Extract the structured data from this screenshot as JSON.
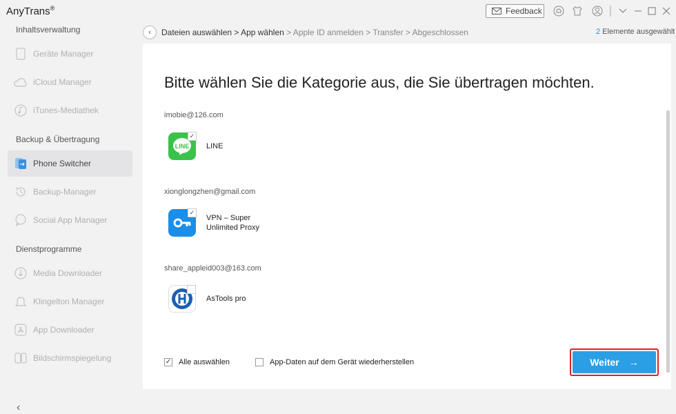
{
  "app": {
    "title": "AnyTrans",
    "trademark": "®"
  },
  "toolbar": {
    "feedback_label": "Feedback"
  },
  "sidebar": {
    "section1": "Inhaltsverwaltung",
    "items1": [
      {
        "label": "Geräte Manager",
        "icon": "phone-icon"
      },
      {
        "label": "iCloud Manager",
        "icon": "cloud-icon"
      },
      {
        "label": "iTunes-Mediathek",
        "icon": "music-icon"
      }
    ],
    "section2": "Backup & Übertragung",
    "items2": [
      {
        "label": "Phone Switcher",
        "icon": "phone-switch-icon",
        "active": true
      },
      {
        "label": "Backup-Manager",
        "icon": "history-icon"
      },
      {
        "label": "Social App Manager",
        "icon": "chat-icon"
      }
    ],
    "section3": "Dienstprogramme",
    "items3": [
      {
        "label": "Media Downloader",
        "icon": "download-icon"
      },
      {
        "label": "Klingelton Manager",
        "icon": "bell-icon"
      },
      {
        "label": "App Downloader",
        "icon": "app-store-icon"
      },
      {
        "label": "Bildschirmspiegelung",
        "icon": "mirror-icon"
      }
    ]
  },
  "breadcrumb": {
    "current": "Dateien auswählen > App wählen",
    "rest": " > Apple ID anmelden > Transfer > Abgeschlossen"
  },
  "selection": {
    "count": "2",
    "label": " Elemente ausgewählt"
  },
  "main": {
    "heading": "Bitte wählen Sie die Kategorie aus, die Sie übertragen möchten.",
    "groups": [
      {
        "account": "imobie@126.com",
        "app_name_1": "LINE",
        "app_name_2": "",
        "checked": true
      },
      {
        "account": "xionglongzhen@gmail.com",
        "app_name_1": "VPN – Super",
        "app_name_2": "Unlimited Proxy",
        "checked": true
      },
      {
        "account": "share_appleid003@163.com",
        "app_name_1": "AsTools pro",
        "app_name_2": "",
        "checked": false
      }
    ],
    "select_all_label": "Alle auswählen",
    "restore_label": "App-Daten auf dem Gerät wiederherstellen",
    "next_label": "Weiter",
    "next_arrow": "→"
  },
  "colors": {
    "accent": "#2b9fe6",
    "highlight": "#d9232a",
    "line_green": "#3ac24a"
  }
}
